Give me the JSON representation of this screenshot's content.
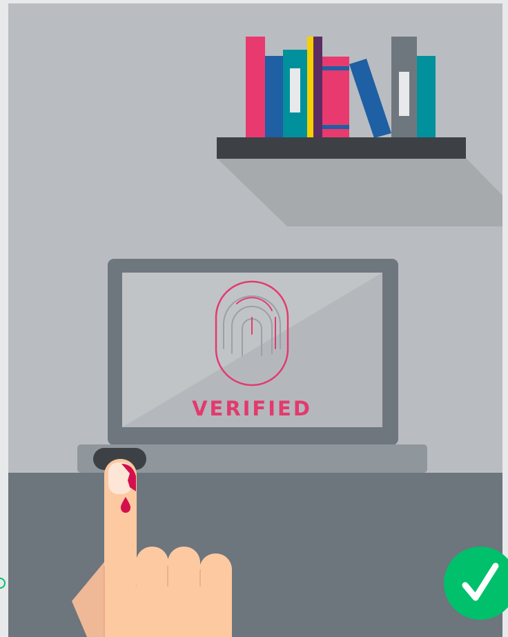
{
  "screen": {
    "status_label": "VERIFIED"
  },
  "icons": {
    "fingerprint": "fingerprint-icon",
    "verified_check": "checkmark-icon"
  },
  "colors": {
    "wall": "#b9bdc1",
    "shelf": "#3d4145",
    "shelf_shadow": "#a6aaad",
    "desk": "#6d757d",
    "laptop_frame": "#6f777e",
    "laptop_screen": "#c1c4c7",
    "laptop_base": "#8f969c",
    "accent_pink": "#e23a6e",
    "success_green": "#00c06b",
    "skin": "#fdc9a1",
    "blood": "#d40f4d"
  }
}
